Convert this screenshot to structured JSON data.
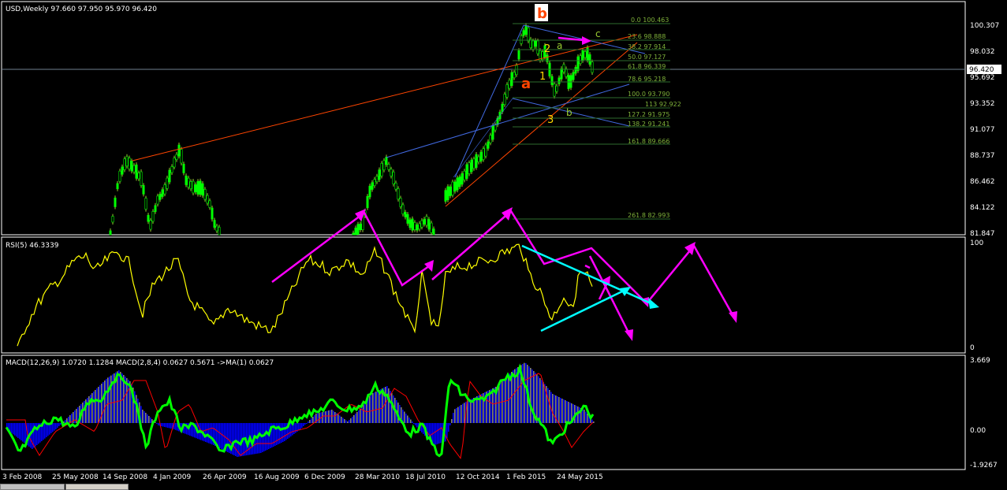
{
  "main_chart": {
    "header": "USD,Weekly  97.660 97.950 95.970 96.420",
    "price_ticks": [
      "100.307",
      "98.032",
      "95.692",
      "93.352",
      "91.077",
      "88.737",
      "86.462",
      "84.122",
      "81.847"
    ],
    "current_price": "96.420",
    "fib_labels": [
      "0.0 100.463",
      "23.6 98.888",
      "38.2 97.914",
      "50.0 97.127",
      "61.8 96.339",
      "78.6 95.218",
      "100.0 93.790",
      "113 92.922",
      "127.2 91.975",
      "138.2 91.241",
      "161.8 89.666",
      "261.8 82.993"
    ],
    "wave_labels": {
      "b": "b",
      "a_big": "a",
      "two": "2",
      "a_small": "a",
      "one": "1",
      "c": "c",
      "three": "3",
      "b_small": "b"
    }
  },
  "rsi_panel": {
    "header": "RSI(5) 46.3339",
    "ticks": [
      "100",
      "0"
    ]
  },
  "macd_panel": {
    "header": "MACD(12,26,9) 1.0720 1.1284  MACD(2,8,4) 0.0627 0.5671  ->MA(1) 0.0627",
    "ticks": [
      "3.669",
      "0.00",
      "-1.9267"
    ]
  },
  "time_axis": [
    "3 Feb 2008",
    "25 May 2008",
    "14 Sep 2008",
    "4 Jan 2009",
    "26 Apr 2009",
    "16 Aug 2009",
    "6 Dec 2009",
    "28 Mar 2010",
    "18 Jul 2010",
    "12 Oct 2014",
    "1 Feb 2015",
    "24 May 2015"
  ],
  "colors": {
    "bull_candle": "#00ff00",
    "wick": "#9acd32",
    "rsi_line": "#ffff00",
    "macd_hist": "#0000ff",
    "macd_hist2": "#808080",
    "macd_line": "#00ff00",
    "signal_line": "#ff0000",
    "projection": "#ff00ff",
    "rsi_trend": "#00ffff",
    "channel_blue": "#4169e1",
    "channel_red": "#ff4500",
    "price_line": "#708090",
    "panel_border": "#ffffff",
    "wave_b": "#ff4500",
    "wave_num": "#ffd700",
    "wave_letter": "#9acd32",
    "fib": "#7fb23a"
  }
}
